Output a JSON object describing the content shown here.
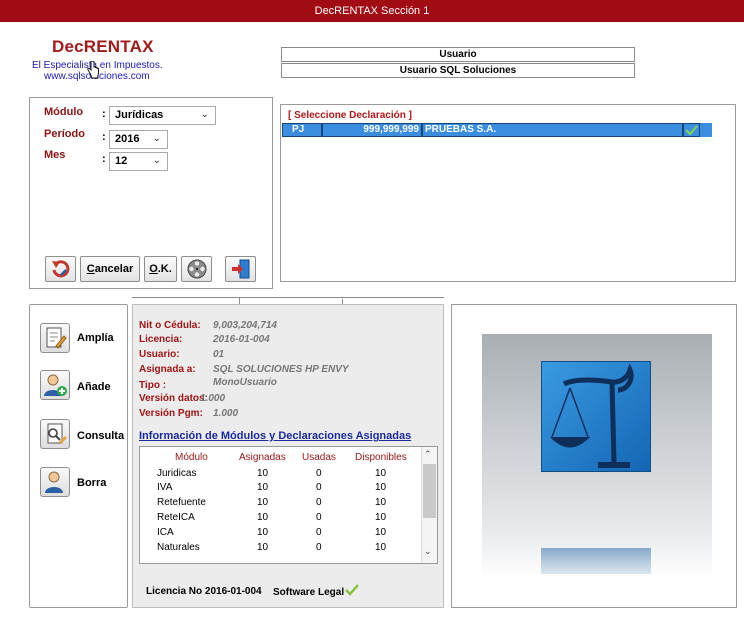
{
  "window": {
    "title": "DecRENTAX Sección 1"
  },
  "brand": {
    "name": "DecRENTAX",
    "tagline": "El Especialista en Impuestos.",
    "website": "www.sqlsoluciones.com"
  },
  "user": {
    "label": "Usuario",
    "name": "Usuario SQL Soluciones"
  },
  "filters": {
    "modulo_label": "Módulo",
    "modulo_value": "Jurídicas",
    "periodo_label": "Período",
    "periodo_value": "2016",
    "mes_label": "Mes",
    "mes_value": "12",
    "colon": ":"
  },
  "toolbar": {
    "cancel_label": "ancelar",
    "cancel_accel": "C",
    "ok_label": ".K.",
    "ok_accel": "O"
  },
  "declarations": {
    "header": "[ Seleccione Declaración ]",
    "rows": [
      {
        "type": "PJ",
        "nit": "999,999,999",
        "name": "PRUEBAS S.A."
      }
    ]
  },
  "actions": [
    {
      "label": "Amplía",
      "icon": "edit-document-icon"
    },
    {
      "label": "Añade",
      "icon": "add-user-icon"
    },
    {
      "label": "Consulta",
      "icon": "search-document-icon"
    },
    {
      "label": "Borra",
      "icon": "delete-user-icon"
    }
  ],
  "license": {
    "nit_label": "Nit o Cédula:",
    "nit_value": "9,003,204,714",
    "licencia_label": "Licencia:",
    "licencia_value": "2016-01-004",
    "usuario_label": "Usuario:",
    "usuario_value": "01",
    "asignada_label": "Asignada a:",
    "asignada_value": "SQL SOLUCIONES HP ENVY",
    "tipo_label": "Tipo :",
    "tipo_value": "MonoUsuario",
    "vdatos_label": "Versión datos:",
    "vdatos_value": "1.000",
    "vpgm_label": "Versión Pgm:",
    "vpgm_value": "1.000"
  },
  "modules": {
    "title": "Información de Módulos y Declaraciones Asignadas",
    "columns": [
      "Módulo",
      "Asignadas",
      "Usadas",
      "Disponibles"
    ],
    "rows": [
      [
        "Juridicas",
        "10",
        "0",
        "10"
      ],
      [
        "IVA",
        "10",
        "0",
        "10"
      ],
      [
        "Retefuente",
        "10",
        "0",
        "10"
      ],
      [
        "ReteICA",
        "10",
        "0",
        "10"
      ],
      [
        "ICA",
        "10",
        "0",
        "10"
      ],
      [
        "Naturales",
        "10",
        "0",
        "10"
      ]
    ]
  },
  "footer": {
    "license_text": "Licencia No 2016-01-004",
    "software_legal": "Software Legal"
  },
  "colors": {
    "titlebar": "#a10b13",
    "selection": "#3b8de0",
    "label_red": "#a01414",
    "link_blue": "#1a2aa0"
  }
}
